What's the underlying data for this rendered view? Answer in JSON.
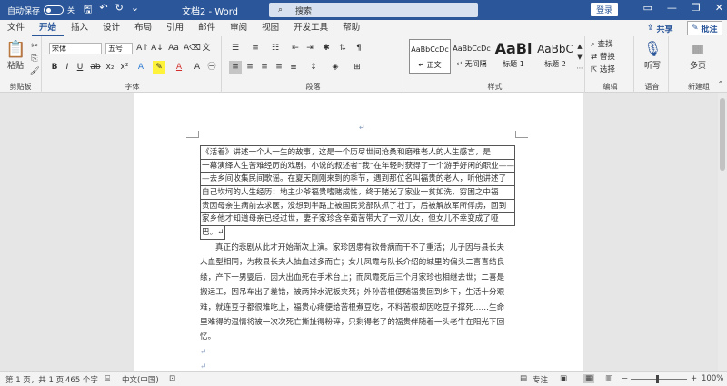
{
  "titlebar": {
    "autosave_label": "自动保存",
    "autosave_state": "关",
    "doc_title": "文档2 - Word",
    "search_placeholder": "搜索",
    "login_label": "登录"
  },
  "tabs": [
    "文件",
    "开始",
    "插入",
    "设计",
    "布局",
    "引用",
    "邮件",
    "审阅",
    "视图",
    "开发工具",
    "帮助"
  ],
  "active_tab": "开始",
  "share_label": "共享",
  "comment_label": "批注",
  "ribbon": {
    "clipboard": {
      "paste_label": "粘贴",
      "group_label": "剪贴板"
    },
    "font": {
      "font_name": "宋体",
      "font_size": "五号",
      "group_label": "字体"
    },
    "paragraph": {
      "group_label": "段落"
    },
    "styles": {
      "group_label": "样式",
      "items": [
        {
          "sample": "AaBbCcDc",
          "name": "↵ 正文"
        },
        {
          "sample": "AaBbCcDc",
          "name": "↵ 无间隔"
        },
        {
          "sample": "AaBl",
          "name": "标题 1"
        },
        {
          "sample": "AaBbC",
          "name": "标题 2"
        }
      ]
    },
    "editing": {
      "find": "查找",
      "replace": "替换",
      "select": "选择",
      "group_label": "编辑"
    },
    "voice": {
      "dictate": "听写",
      "group_label": "语音"
    },
    "newgroup": {
      "pages": "多页",
      "group_label": "新建组"
    }
  },
  "document": {
    "boxed_lines": [
      "《活着》讲述一个人一生的故事，这是一个历尽世间沧桑和磨难老人的人生感言，是",
      "一幕演绎人生苦难经历的戏剧。小说的叙述者“我”在年轻时获得了一个游手好闲的职业——",
      "—去乡间收集民间歌谣。在夏天刚刚来到的季节，遇到那位名叫福贵的老人，听他讲述了",
      "自己坎坷的人生经历：地主少爷福贵嗜赌成性，终于赌光了家业一贫如洗，穷困之中福",
      "贵因母亲生病前去求医，没想到半路上被国民党部队抓了壮丁，后被解放军所俘虏，回到",
      "家乡他才知道母亲已经过世，妻子家珍含辛茹苦带大了一双儿女，但女儿不幸变成了哑",
      "巴。↵"
    ],
    "body_lines": [
      "真正的悲剧从此才开始渐次上演。家珍因患有软骨病而干不了重活；儿子因与县长夫",
      "人血型相同，为救县长夫人抽血过多而亡；女儿凤霞与队长介绍的城里的偏头二喜喜结良",
      "缘，产下一男婴后，因大出血死在手术台上；而凤霞死后三个月家珍也相继去世；二喜是",
      "搬运工，因吊车出了差错，被两排水泥板夹死；外孙苦根便随福贵回到乡下，生活十分艰",
      "难，就连豆子都很难吃上，福贵心疼便给苦根煮豆吃，不料苦根却因吃豆子撑死……生命",
      "里难得的温情将被一次次死亡撕扯得粉碎，只剩得老了的福贵伴随着一头老牛在阳光下回",
      "忆。"
    ],
    "end_mark": "↵"
  },
  "status": {
    "page": "第 1 页，共 1 页",
    "words": "465 个字",
    "lang": "中文(中国)",
    "focus": "专注",
    "zoom": "100%"
  },
  "colors": {
    "brand": "#2b579a"
  }
}
